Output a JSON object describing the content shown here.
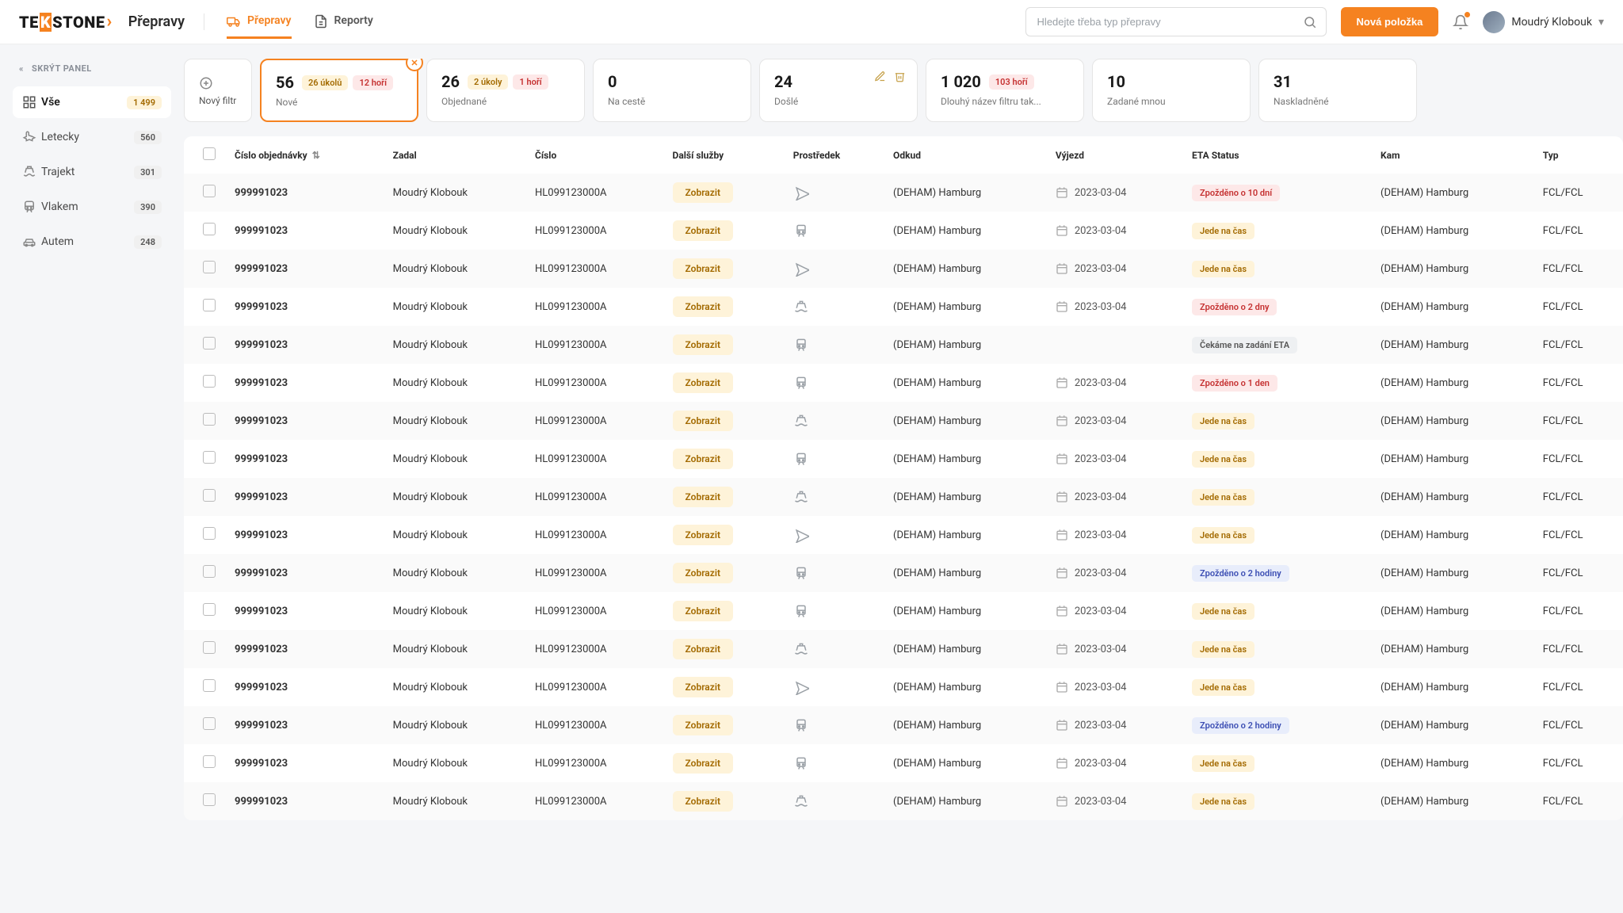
{
  "header": {
    "logo_prefix": "TE",
    "logo_mid": "STONE",
    "app_title": "Přepravy",
    "tabs": [
      {
        "label": "Přepravy",
        "active": true
      },
      {
        "label": "Reporty",
        "active": false
      }
    ],
    "search_placeholder": "Hledejte třeba typ přepravy",
    "new_button": "Nová položka",
    "user_name": "Moudrý Klobouk"
  },
  "sidebar": {
    "hide_label": "SKRÝT PANEL",
    "items": [
      {
        "icon": "grid",
        "label": "Vše",
        "count": "1 499",
        "active": true
      },
      {
        "icon": "plane",
        "label": "Letecky",
        "count": "560"
      },
      {
        "icon": "ferry",
        "label": "Trajekt",
        "count": "301"
      },
      {
        "icon": "train",
        "label": "Vlakem",
        "count": "390"
      },
      {
        "icon": "car",
        "label": "Autem",
        "count": "248"
      }
    ]
  },
  "filters": {
    "new_filter": "Nový filtr",
    "cards": [
      {
        "count": "56",
        "label": "Nové",
        "chips": [
          {
            "text": "26 úkolů",
            "tone": "yellow"
          },
          {
            "text": "12 hoří",
            "tone": "red"
          }
        ],
        "active": true,
        "closeable": true
      },
      {
        "count": "26",
        "label": "Objednané",
        "chips": [
          {
            "text": "2 úkoly",
            "tone": "yellow"
          },
          {
            "text": "1 hoří",
            "tone": "red"
          }
        ]
      },
      {
        "count": "0",
        "label": "Na cestě",
        "chips": []
      },
      {
        "count": "24",
        "label": "Došlé",
        "chips": [],
        "editable": true
      },
      {
        "count": "1 020",
        "label": "Dlouhý název filtru tak...",
        "chips": [
          {
            "text": "103 hoří",
            "tone": "red"
          }
        ]
      },
      {
        "count": "10",
        "label": "Zadané mnou",
        "chips": []
      },
      {
        "count": "31",
        "label": "Naskladněné",
        "chips": []
      }
    ]
  },
  "table": {
    "columns": [
      "Číslo objednávky",
      "Zadal",
      "Číslo",
      "Další služby",
      "Prostředek",
      "Odkud",
      "Výjezd",
      "ETA Status",
      "Kam",
      "Typ"
    ],
    "show_label": "Zobrazit",
    "rows": [
      {
        "order": "999991023",
        "by": "Moudrý Klobouk",
        "num": "HL099123000A",
        "mode": "plane",
        "from": "(DEHAM) Hamburg",
        "date": "2023-03-04",
        "status": {
          "text": "Zpožděno o 10 dní",
          "tone": "late"
        },
        "to": "(DEHAM) Hamburg",
        "type": "FCL/FCL"
      },
      {
        "order": "999991023",
        "by": "Moudrý Klobouk",
        "num": "HL099123000A",
        "mode": "train",
        "from": "(DEHAM) Hamburg",
        "date": "2023-03-04",
        "status": {
          "text": "Jede na čas",
          "tone": "ontime"
        },
        "to": "(DEHAM) Hamburg",
        "type": "FCL/FCL"
      },
      {
        "order": "999991023",
        "by": "Moudrý Klobouk",
        "num": "HL099123000A",
        "mode": "plane",
        "from": "(DEHAM) Hamburg",
        "date": "2023-03-04",
        "status": {
          "text": "Jede na čas",
          "tone": "ontime"
        },
        "to": "(DEHAM) Hamburg",
        "type": "FCL/FCL"
      },
      {
        "order": "999991023",
        "by": "Moudrý Klobouk",
        "num": "HL099123000A",
        "mode": "ferry",
        "from": "(DEHAM) Hamburg",
        "date": "2023-03-04",
        "status": {
          "text": "Zpožděno o 2 dny",
          "tone": "late"
        },
        "to": "(DEHAM) Hamburg",
        "type": "FCL/FCL"
      },
      {
        "order": "999991023",
        "by": "Moudrý Klobouk",
        "num": "HL099123000A",
        "mode": "train",
        "from": "(DEHAM) Hamburg",
        "date": "",
        "status": {
          "text": "Čekáme na zadání ETA",
          "tone": "wait"
        },
        "to": "(DEHAM) Hamburg",
        "type": "FCL/FCL"
      },
      {
        "order": "999991023",
        "by": "Moudrý Klobouk",
        "num": "HL099123000A",
        "mode": "train",
        "from": "(DEHAM) Hamburg",
        "date": "2023-03-04",
        "status": {
          "text": "Zpožděno o 1 den",
          "tone": "late"
        },
        "to": "(DEHAM) Hamburg",
        "type": "FCL/FCL"
      },
      {
        "order": "999991023",
        "by": "Moudrý Klobouk",
        "num": "HL099123000A",
        "mode": "ferry",
        "from": "(DEHAM) Hamburg",
        "date": "2023-03-04",
        "status": {
          "text": "Jede na čas",
          "tone": "ontime"
        },
        "to": "(DEHAM) Hamburg",
        "type": "FCL/FCL"
      },
      {
        "order": "999991023",
        "by": "Moudrý Klobouk",
        "num": "HL099123000A",
        "mode": "train",
        "from": "(DEHAM) Hamburg",
        "date": "2023-03-04",
        "status": {
          "text": "Jede na čas",
          "tone": "ontime"
        },
        "to": "(DEHAM) Hamburg",
        "type": "FCL/FCL"
      },
      {
        "order": "999991023",
        "by": "Moudrý Klobouk",
        "num": "HL099123000A",
        "mode": "ferry",
        "from": "(DEHAM) Hamburg",
        "date": "2023-03-04",
        "status": {
          "text": "Jede na čas",
          "tone": "ontime"
        },
        "to": "(DEHAM) Hamburg",
        "type": "FCL/FCL"
      },
      {
        "order": "999991023",
        "by": "Moudrý Klobouk",
        "num": "HL099123000A",
        "mode": "plane",
        "from": "(DEHAM) Hamburg",
        "date": "2023-03-04",
        "status": {
          "text": "Jede na čas",
          "tone": "ontime"
        },
        "to": "(DEHAM) Hamburg",
        "type": "FCL/FCL"
      },
      {
        "order": "999991023",
        "by": "Moudrý Klobouk",
        "num": "HL099123000A",
        "mode": "train",
        "from": "(DEHAM) Hamburg",
        "date": "2023-03-04",
        "status": {
          "text": "Zpožděno o 2 hodiny",
          "tone": "info"
        },
        "to": "(DEHAM) Hamburg",
        "type": "FCL/FCL"
      },
      {
        "order": "999991023",
        "by": "Moudrý Klobouk",
        "num": "HL099123000A",
        "mode": "train",
        "from": "(DEHAM) Hamburg",
        "date": "2023-03-04",
        "status": {
          "text": "Jede na čas",
          "tone": "ontime"
        },
        "to": "(DEHAM) Hamburg",
        "type": "FCL/FCL"
      },
      {
        "order": "999991023",
        "by": "Moudrý Klobouk",
        "num": "HL099123000A",
        "mode": "ferry",
        "from": "(DEHAM) Hamburg",
        "date": "2023-03-04",
        "status": {
          "text": "Jede na čas",
          "tone": "ontime"
        },
        "to": "(DEHAM) Hamburg",
        "type": "FCL/FCL"
      },
      {
        "order": "999991023",
        "by": "Moudrý Klobouk",
        "num": "HL099123000A",
        "mode": "plane",
        "from": "(DEHAM) Hamburg",
        "date": "2023-03-04",
        "status": {
          "text": "Jede na čas",
          "tone": "ontime"
        },
        "to": "(DEHAM) Hamburg",
        "type": "FCL/FCL"
      },
      {
        "order": "999991023",
        "by": "Moudrý Klobouk",
        "num": "HL099123000A",
        "mode": "train",
        "from": "(DEHAM) Hamburg",
        "date": "2023-03-04",
        "status": {
          "text": "Zpožděno o 2 hodiny",
          "tone": "info"
        },
        "to": "(DEHAM) Hamburg",
        "type": "FCL/FCL"
      },
      {
        "order": "999991023",
        "by": "Moudrý Klobouk",
        "num": "HL099123000A",
        "mode": "train",
        "from": "(DEHAM) Hamburg",
        "date": "2023-03-04",
        "status": {
          "text": "Jede na čas",
          "tone": "ontime"
        },
        "to": "(DEHAM) Hamburg",
        "type": "FCL/FCL"
      },
      {
        "order": "999991023",
        "by": "Moudrý Klobouk",
        "num": "HL099123000A",
        "mode": "ferry",
        "from": "(DEHAM) Hamburg",
        "date": "2023-03-04",
        "status": {
          "text": "Jede na čas",
          "tone": "ontime"
        },
        "to": "(DEHAM) Hamburg",
        "type": "FCL/FCL"
      }
    ]
  }
}
